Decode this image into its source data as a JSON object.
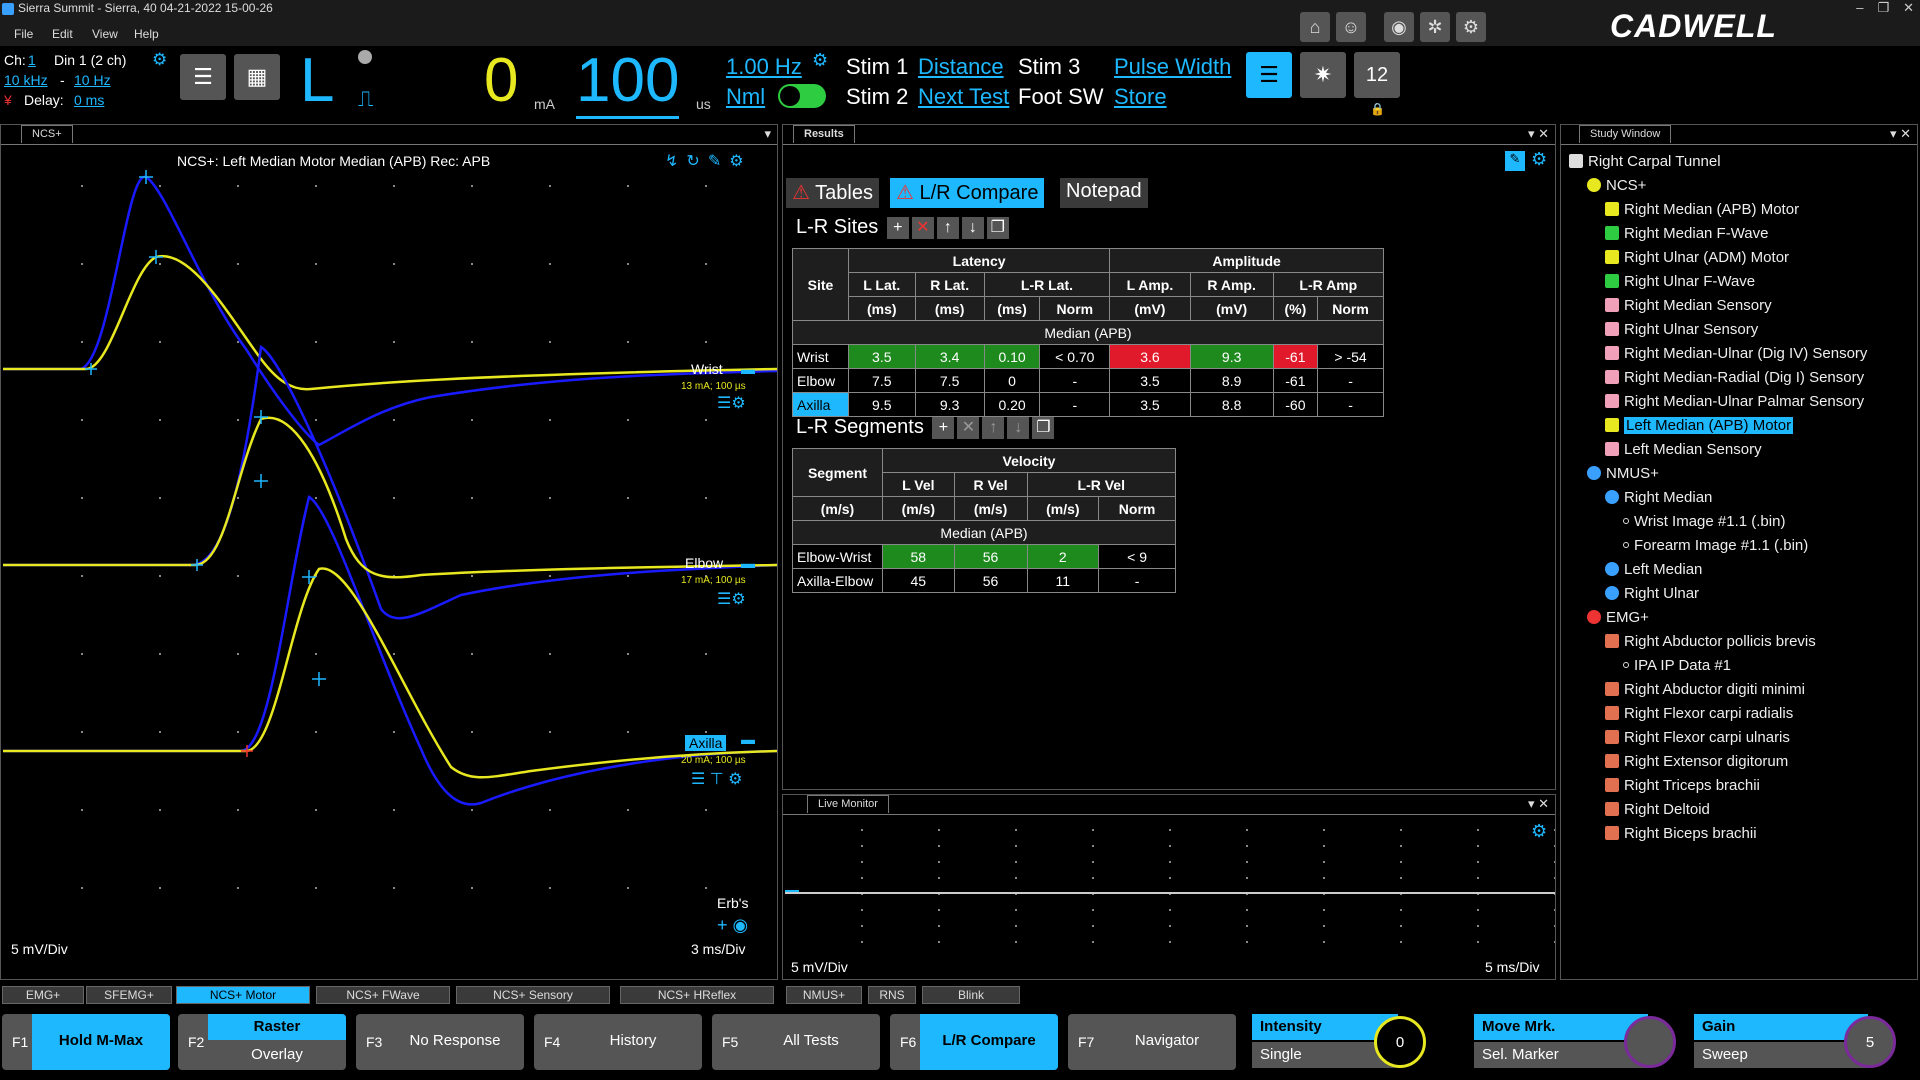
{
  "window": {
    "title": "Sierra Summit - Sierra, 40 04-21-2022 15-00-26",
    "menu": [
      "File",
      "Edit",
      "View",
      "Help"
    ],
    "controls": [
      "–",
      "❐",
      "✕"
    ]
  },
  "brand": {
    "logo": "CADWELL"
  },
  "toolbar": {
    "channel": "Ch:",
    "channel_value": "1",
    "din": "Din 1 (2 ch)",
    "hi_filter": "10 kHz",
    "filter_sep": "-",
    "lo_filter": "10 Hz",
    "delay_label": "Delay:",
    "delay_value": "0 ms",
    "side": "L",
    "pulse_symbol": "⎍",
    "intensity_value": "0",
    "intensity_unit": "mA",
    "duration_value": "100",
    "duration_unit": "us",
    "rate": "1.00 Hz",
    "mode": "Nml",
    "stim1": "Stim 1",
    "stim1_link": "Distance",
    "stim3": "Stim 3",
    "stim3_link": "Pulse Width",
    "stim2": "Stim 2",
    "stim2_link": "Next Test",
    "footsw": "Foot SW",
    "footsw_link": "Store",
    "page_badge": "12"
  },
  "waveform": {
    "tab": "NCS+",
    "header": "NCS+: Left Median Motor   Median (APB)   Rec: APB",
    "traces": [
      {
        "label": "Wrist",
        "stim": "13 mA; 100 µs"
      },
      {
        "label": "Elbow",
        "stim": "17 mA; 100 µs"
      },
      {
        "label": "Axilla",
        "stim": "20 mA; 100 µs"
      }
    ],
    "erbs": "Erb's",
    "sensitivity": "5 mV/Div",
    "timebase": "3 ms/Div",
    "colors": {
      "trace_primary": "#1a1aff",
      "trace_secondary": "#e8e820",
      "marker": "#1eb8ff"
    }
  },
  "results": {
    "tab": "Results",
    "tabs": [
      "Tables",
      "L/R Compare",
      "Notepad"
    ],
    "sites_title": "L-R Sites",
    "sites_headers": {
      "site": "Site",
      "latency": "Latency",
      "amplitude": "Amplitude",
      "cols": [
        "L Lat.",
        "R Lat.",
        "L-R Lat.",
        "",
        "L Amp.",
        "R Amp.",
        "L-R Amp",
        ""
      ],
      "units": [
        "(ms)",
        "(ms)",
        "(ms)",
        "Norm",
        "(mV)",
        "(mV)",
        "(%)",
        "Norm"
      ]
    },
    "sites_section": "Median (APB)",
    "sites_rows": [
      [
        "Wrist",
        "3.5",
        "3.4",
        "0.10",
        "< 0.70",
        "3.6",
        "9.3",
        "-61",
        "> -54"
      ],
      [
        "Elbow",
        "7.5",
        "7.5",
        "0",
        "-",
        "3.5",
        "8.9",
        "-61",
        "-"
      ],
      [
        "Axilla",
        "9.5",
        "9.3",
        "0.20",
        "-",
        "3.5",
        "8.8",
        "-60",
        "-"
      ]
    ],
    "segments_title": "L-R Segments",
    "seg_headers": {
      "segment": "Segment",
      "velocity": "Velocity",
      "cols": [
        "L Vel",
        "R Vel",
        "L-R Vel",
        ""
      ],
      "units": [
        "(m/s)",
        "(m/s)",
        "(m/s)",
        "Norm"
      ]
    },
    "seg_section": "Median (APB)",
    "seg_rows": [
      [
        "Elbow-Wrist",
        "58",
        "56",
        "2",
        "< 9"
      ],
      [
        "Axilla-Elbow",
        "45",
        "56",
        "11",
        "-"
      ]
    ]
  },
  "live_monitor": {
    "tab": "Live Monitor",
    "sensitivity": "5 mV/Div",
    "timebase": "5 ms/Div"
  },
  "study": {
    "tab": "Study Window",
    "items": [
      {
        "label": "Right Carpal Tunnel",
        "level": 0,
        "icon": "study-icon"
      },
      {
        "label": "NCS+",
        "level": 1,
        "icon": "ncs-icon"
      },
      {
        "label": "Right Median (APB) Motor",
        "level": 2,
        "icon": "motor-test-icon"
      },
      {
        "label": "Right Median F-Wave",
        "level": 2,
        "icon": "fwave-test-icon"
      },
      {
        "label": "Right Ulnar (ADM) Motor",
        "level": 2,
        "icon": "motor-test-icon"
      },
      {
        "label": "Right Ulnar F-Wave",
        "level": 2,
        "icon": "fwave-test-icon"
      },
      {
        "label": "Right Median Sensory",
        "level": 2,
        "icon": "sensory-test-icon"
      },
      {
        "label": "Right Ulnar Sensory",
        "level": 2,
        "icon": "sensory-test-icon"
      },
      {
        "label": "Right Median-Ulnar (Dig IV) Sensory",
        "level": 2,
        "icon": "sensory-test-icon"
      },
      {
        "label": "Right Median-Radial (Dig I) Sensory",
        "level": 2,
        "icon": "sensory-test-icon"
      },
      {
        "label": "Right Median-Ulnar Palmar Sensory",
        "level": 2,
        "icon": "sensory-test-icon"
      },
      {
        "label": "Left Median (APB) Motor",
        "level": 2,
        "icon": "motor-test-icon",
        "selected": true
      },
      {
        "label": "Left Median Sensory",
        "level": 2,
        "icon": "sensory-test-icon"
      },
      {
        "label": "NMUS+",
        "level": 1,
        "icon": "nmus-icon"
      },
      {
        "label": "Right Median",
        "level": 2,
        "icon": "nmus-nerve-icon"
      },
      {
        "label": "Wrist Image #1.1 (.bin)",
        "level": 3,
        "icon": "bullet-icon"
      },
      {
        "label": "Forearm Image #1.1 (.bin)",
        "level": 3,
        "icon": "bullet-icon"
      },
      {
        "label": "Left Median",
        "level": 2,
        "icon": "nmus-nerve-icon"
      },
      {
        "label": "Right Ulnar",
        "level": 2,
        "icon": "nmus-nerve-icon"
      },
      {
        "label": "EMG+",
        "level": 1,
        "icon": "emg-icon"
      },
      {
        "label": "Right Abductor pollicis brevis",
        "level": 2,
        "icon": "muscle-icon"
      },
      {
        "label": "IPA IP Data #1",
        "level": 3,
        "icon": "bullet-icon"
      },
      {
        "label": "Right Abductor digiti minimi",
        "level": 2,
        "icon": "muscle-icon"
      },
      {
        "label": "Right Flexor carpi radialis",
        "level": 2,
        "icon": "muscle-icon"
      },
      {
        "label": "Right Flexor carpi ulnaris",
        "level": 2,
        "icon": "muscle-icon"
      },
      {
        "label": "Right Extensor digitorum",
        "level": 2,
        "icon": "muscle-icon"
      },
      {
        "label": "Right Triceps brachii",
        "level": 2,
        "icon": "muscle-icon"
      },
      {
        "label": "Right Deltoid",
        "level": 2,
        "icon": "muscle-icon"
      },
      {
        "label": "Right Biceps brachii",
        "level": 2,
        "icon": "muscle-icon"
      }
    ]
  },
  "steps": [
    {
      "label": "EMG+",
      "active": false
    },
    {
      "label": "SFEMG+",
      "active": false
    },
    {
      "label": "NCS+ Motor",
      "active": true
    },
    {
      "label": "NCS+ FWave",
      "active": false
    },
    {
      "label": "NCS+ Sensory",
      "active": false
    },
    {
      "label": "NCS+ HReflex",
      "active": false
    },
    {
      "label": "NMUS+",
      "active": false
    },
    {
      "label": "RNS",
      "active": false
    },
    {
      "label": "Blink",
      "active": false
    }
  ],
  "fkeys": [
    {
      "key": "F1",
      "label": "Hold M-Max",
      "on": true
    },
    {
      "key": "F2",
      "label": "Raster",
      "sub": "Overlay",
      "on": false
    },
    {
      "key": "F3",
      "label": "No Response",
      "on": false
    },
    {
      "key": "F4",
      "label": "History",
      "on": false
    },
    {
      "key": "F5",
      "label": "All Tests",
      "on": false
    },
    {
      "key": "F6",
      "label": "L/R Compare",
      "on": true
    },
    {
      "key": "F7",
      "label": "Navigator",
      "on": false
    }
  ],
  "knobs": [
    {
      "title": "Intensity",
      "sub": "Single",
      "value": "0",
      "accent": "#e8e820",
      "bg": "#1eb8ff"
    },
    {
      "title": "Move Mrk.",
      "sub": "Sel. Marker",
      "value": "",
      "accent": "#7a2a9a",
      "bg": "#1eb8ff"
    },
    {
      "title": "Gain",
      "sub": "Sweep",
      "value": "5",
      "accent": "#7a2a9a",
      "bg": "#1eb8ff"
    }
  ]
}
